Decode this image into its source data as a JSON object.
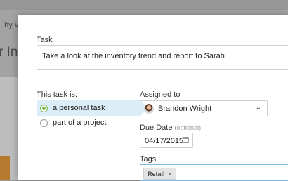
{
  "background": {
    "byline": ", by W",
    "heading": "r Inv"
  },
  "task_form": {
    "task_label": "Task",
    "task_value": "Take a look at the inventory trend and report to Sarah",
    "type_label": "This task is:",
    "type_options": [
      {
        "label": "a personal task",
        "selected": true
      },
      {
        "label": "part of a project",
        "selected": false
      }
    ],
    "assigned_label": "Assigned to",
    "assignee_name": "Brandon Wright",
    "due_label": "Due Date",
    "due_optional": "(optional)",
    "due_value": "04/17/2015",
    "tags_label": "Tags",
    "tags": [
      "Retail"
    ]
  },
  "icons": {
    "chevron": "chevron-down-icon",
    "calendar": "calendar-icon",
    "tag_remove": "close-icon"
  },
  "colors": {
    "accent_green": "#7ab648",
    "selection_bg": "#dbeef8",
    "focus_border": "#7fb9e6"
  }
}
